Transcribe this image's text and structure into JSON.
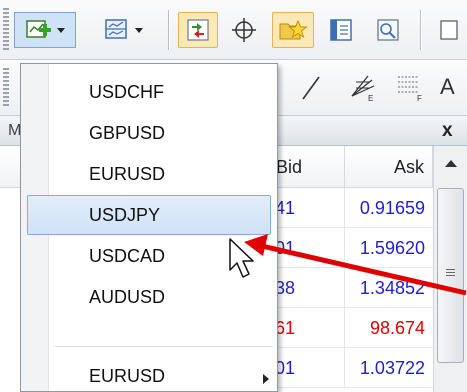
{
  "toolbar": {
    "icons": [
      "new-chart-icon",
      "profiles-icon",
      "market-watch-icon",
      "crosshair-icon",
      "navigator-icon",
      "terminal-icon",
      "strategy-tester-icon"
    ],
    "row2_letter": "A"
  },
  "panel": {
    "title_char": "M",
    "close": "x",
    "columns": {
      "bid": "Bid",
      "ask": "Ask"
    },
    "rows": [
      {
        "bid": "41",
        "ask": "0.91659",
        "bid_color": "#1f1fd0",
        "ask_color": "#1f1fd0"
      },
      {
        "bid": "01",
        "ask": "1.59620",
        "bid_color": "#1f1fd0",
        "ask_color": "#1f1fd0"
      },
      {
        "bid": "38",
        "ask": "1.34852",
        "bid_color": "#1f1fd0",
        "ask_color": "#1f1fd0"
      },
      {
        "bid": "61",
        "ask": "98.674",
        "bid_color": "#e00000",
        "ask_color": "#e00000"
      },
      {
        "bid": "01",
        "ask": "1.03722",
        "bid_color": "#1f1fd0",
        "ask_color": "#1f1fd0"
      }
    ]
  },
  "menu": {
    "items": [
      {
        "label": "USDCHF"
      },
      {
        "label": "GBPUSD"
      },
      {
        "label": "EURUSD"
      },
      {
        "label": "USDJPY",
        "highlighted": true
      },
      {
        "label": "USDCAD"
      },
      {
        "label": "AUDUSD"
      },
      {
        "label": "EURUSD",
        "has_submenu": true
      }
    ]
  },
  "annotation": {
    "arrow_color": "#e00000"
  }
}
